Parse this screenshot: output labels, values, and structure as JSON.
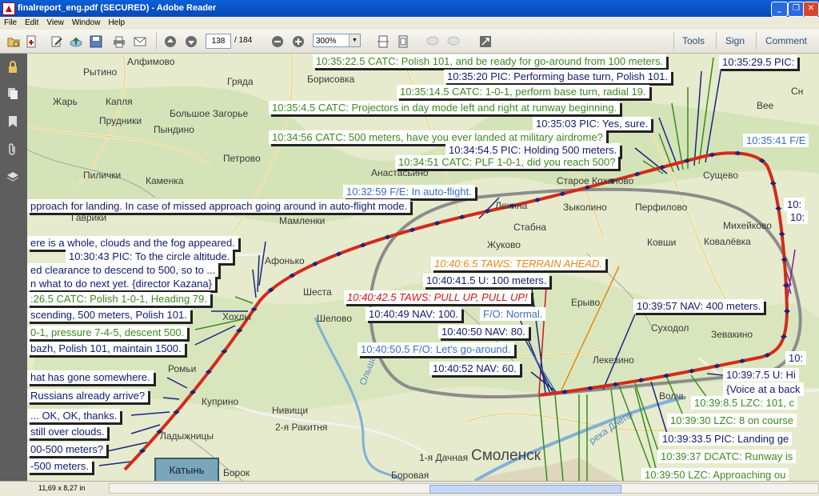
{
  "window": {
    "title": "finalreport_eng.pdf (SECURED) - Adobe Reader"
  },
  "menu": [
    "File",
    "Edit",
    "View",
    "Window",
    "Help"
  ],
  "toolbar": {
    "page_current": "138",
    "page_total": "/ 184",
    "zoom": "300%",
    "tools": "Tools",
    "sign": "Sign",
    "comment": "Comment"
  },
  "status": {
    "page_size": "11,69 x 8,27 in"
  },
  "colors": {
    "route": "#d42a1a",
    "approach_circle": "#8c8c8c",
    "atc": "#3b8b1d",
    "crew": "#0f1b6b",
    "flight_engineer": "#3b6fc4",
    "taws_terrain": "#e58a12",
    "taws_pull_up": "#d21414"
  },
  "places": [
    "Алфимово",
    "Рытино",
    "Грядa",
    "Борисовка",
    "Жарь",
    "Капля",
    "Большое Загорье",
    "Прудники",
    "Пындино",
    "Петрово",
    "Пилички",
    "Каменка",
    "Анастасьино",
    "Старое Коханово",
    "Сущево",
    "Лехина",
    "Зыколино",
    "Перфилово",
    "Гаврики",
    "Мамленки",
    "Стабна",
    "Жуково",
    "Ковши",
    "Михейково",
    "Ковалёвка",
    "Афонько",
    "Шеста",
    "Ерыво",
    "Шелово",
    "Хохлы",
    "Суходол",
    "Зевакино",
    "Лекезино",
    "Ромьи",
    "Куприно",
    "Волчь",
    "Нивищи",
    "2-я Ракитня",
    "Ладыжницы",
    "1-я Дачная",
    "Смоленск",
    "Боровая",
    "Борок",
    "Ольшанка",
    "река Днепр",
    "Катынь",
    "Сн",
    "Вее"
  ],
  "labels": [
    {
      "text": "10:35:22.5 CATC: Polish 101, and be ready for go-around from 100 meters.",
      "color": "green"
    },
    {
      "text": "10:35:29.5 PIC:",
      "color": "navy"
    },
    {
      "text": "10:35:20 PIC: Performing base turn, Polish 101.",
      "color": "navy"
    },
    {
      "text": "10:35:14.5 CATC: 1-0-1, perform base turn, radial 19.",
      "color": "green"
    },
    {
      "text": "10:35:4.5 CATC: Projectors in day mode left and right at runway beginning.",
      "color": "green"
    },
    {
      "text": "10:35:03 PIC: Yes, sure.",
      "color": "navy"
    },
    {
      "text": "10:34:56 CATC: 500 meters, have you ever landed at military airdrome?",
      "color": "green"
    },
    {
      "text": "10:35:41 F/E",
      "color": "blue"
    },
    {
      "text": "10:34:54.5 PIC: Holding 500 meters.",
      "color": "navy"
    },
    {
      "text": "10:34:51 CATC: PLF 1-0-1, did you reach 500?",
      "color": "green"
    },
    {
      "text": "10:32:59 F/E: In auto-flight.",
      "color": "blue"
    },
    {
      "text": "pproach for landing. In case of missed approach going around in auto-flight mode.",
      "color": "navy"
    },
    {
      "text": "ere is a whole, clouds and the fog appeared.",
      "color": "navy"
    },
    {
      "text": "10:30:43 PIC: To the circle altitude.",
      "color": "navy"
    },
    {
      "text": "ed clearance to descend to 500, so to ...",
      "color": "navy"
    },
    {
      "text": "n what to do next yet. {director Kazana}",
      "color": "navy"
    },
    {
      "text": ":26.5 CATC: Polish 1-0-1, Heading 79.",
      "color": "green"
    },
    {
      "text": "scending, 500 meters, Polish 101.",
      "color": "navy"
    },
    {
      "text": "0-1, pressure 7-4-5, descent 500.",
      "color": "green"
    },
    {
      "text": "bazh, Polish 101, maintain 1500.",
      "color": "navy"
    },
    {
      "text": "hat has gone somewhere.",
      "color": "navy"
    },
    {
      "text": "Russians already arrive?",
      "color": "navy"
    },
    {
      "text": "... OK, OK, thanks.",
      "color": "navy"
    },
    {
      "text": "still over clouds.",
      "color": "navy"
    },
    {
      "text": "00-500 meters?",
      "color": "navy"
    },
    {
      "text": "-500 meters.",
      "color": "navy"
    },
    {
      "text": "10:40:6.5 TAWS: TERRAIN AHEAD.",
      "color": "orange"
    },
    {
      "text": "10:40:41.5 U: 100 meters.",
      "color": "navy"
    },
    {
      "text": "10:40:42.5 TAWS: PULL UP, PULL UP!",
      "color": "red"
    },
    {
      "text": "10:40:49 NAV: 100.",
      "color": "navy"
    },
    {
      "text": "F/O: Normal.",
      "color": "blue"
    },
    {
      "text": "10:39:57 NAV: 400 meters.",
      "color": "navy"
    },
    {
      "text": "10:40:50 NAV: 80.",
      "color": "navy"
    },
    {
      "text": "10:40:50.5 F/O: Let's go-around.",
      "color": "blue"
    },
    {
      "text": "10:40:52 NAV: 60.",
      "color": "navy"
    },
    {
      "text": "10:39:7.5 U: Hi",
      "color": "navy"
    },
    {
      "text": "{Voice at a back",
      "color": "navy"
    },
    {
      "text": "10:39:8.5 LZC: 101, c",
      "color": "green"
    },
    {
      "text": "10:39:30 LZC: 8 on course",
      "color": "green"
    },
    {
      "text": "10:39:33.5 PIC: Landing ge",
      "color": "navy"
    },
    {
      "text": "10:39:37 DCATC: Runway is",
      "color": "green"
    },
    {
      "text": "10:39:50 LZC: Approaching ou",
      "color": "green"
    },
    {
      "text": "10:",
      "color": "navy"
    },
    {
      "text": "10:",
      "color": "navy"
    },
    {
      "text": "10:",
      "color": "navy"
    }
  ]
}
